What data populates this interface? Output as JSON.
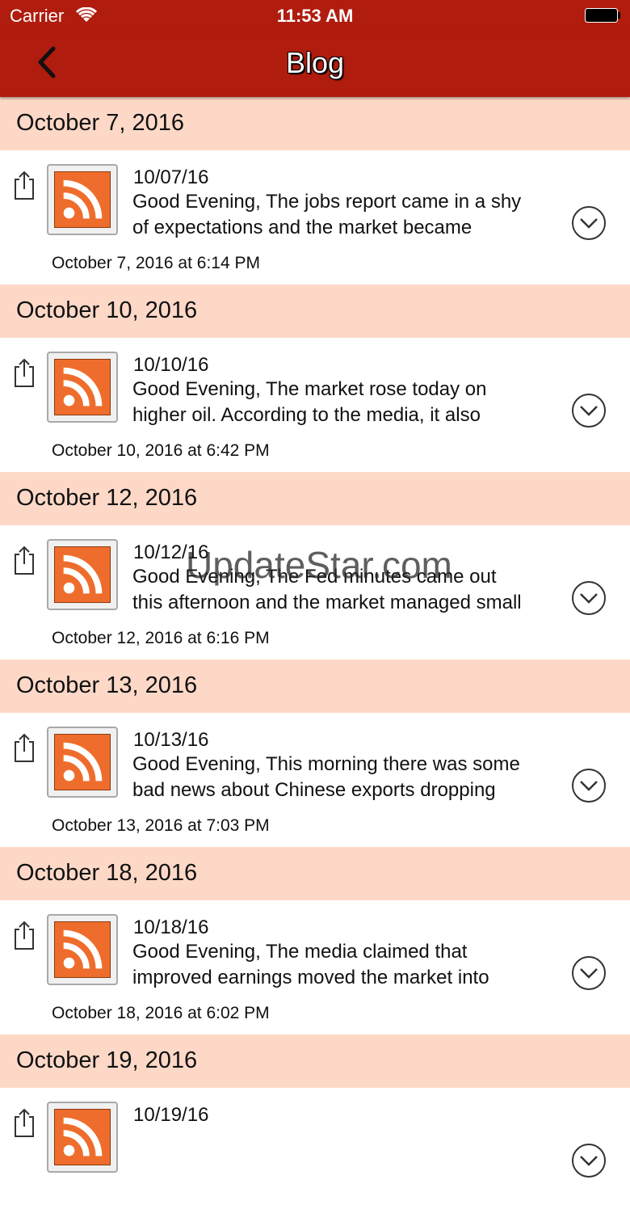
{
  "status": {
    "carrier": "Carrier",
    "time": "11:53 AM"
  },
  "nav": {
    "title": "Blog",
    "back_icon": "chevron-left-icon"
  },
  "watermark": "UpdateStar.com",
  "posts": [
    {
      "section": "October 7, 2016",
      "date": "10/07/16",
      "excerpt": "Good Evening, The jobs report came in a shy\nof expectations and the market became",
      "timestamp": "October 7, 2016 at 6:14 PM"
    },
    {
      "section": "October 10, 2016",
      "date": "10/10/16",
      "excerpt": "Good Evening, The market rose today on\nhigher oil. According to the media, it also",
      "timestamp": "October 10, 2016 at 6:42 PM"
    },
    {
      "section": "October 12, 2016",
      "date": "10/12/16",
      "excerpt": "Good Evening, The Fed minutes came out\nthis afternoon and the market managed small",
      "timestamp": "October 12, 2016 at 6:16 PM"
    },
    {
      "section": "October 13, 2016",
      "date": "10/13/16",
      "excerpt": "Good Evening, This morning there was some\nbad news about Chinese exports dropping",
      "timestamp": "October 13, 2016 at 7:03 PM"
    },
    {
      "section": "October 18, 2016",
      "date": "10/18/16",
      "excerpt": "Good Evening, The media claimed that\nimproved earnings moved the market into",
      "timestamp": "October 18, 2016 at 6:02 PM"
    },
    {
      "section": "October 19, 2016",
      "date": "10/19/16",
      "excerpt": "",
      "timestamp": ""
    }
  ],
  "colors": {
    "nav_bg": "#b01c0e",
    "section_bg": "#fdd8c7",
    "rss_orange": "#ef6d2c"
  }
}
